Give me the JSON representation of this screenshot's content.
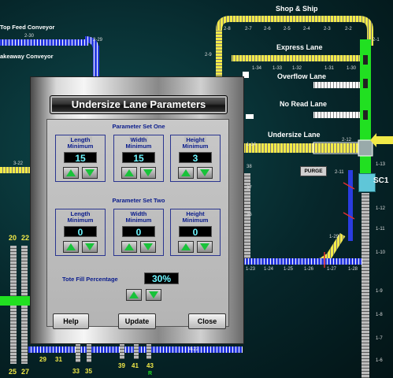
{
  "background_labels": {
    "top_feed": "Top Feed Conveyor",
    "takeaway": "akeaway Conveyor",
    "shop_ship": "Shop & Ship",
    "express": "Express Lane",
    "overflow": "Overflow Lane",
    "no_read": "No Read Lane",
    "undersize": "Undersize Lane",
    "purge": "PURGE",
    "sc1": "SC1",
    "n2_30": "2-30",
    "n2_29": "2-29",
    "n2_9": "2-9",
    "n2_8": "2-8",
    "n2_7": "2-7",
    "n2_6": "2-6",
    "n2_5": "2-5",
    "n2_4": "2-4",
    "n2_3": "2-3",
    "n2_2": "2-2",
    "n2_1": "2-1",
    "n1_34": "1-34",
    "n1_33": "1-33",
    "n1_32": "1-32",
    "n1_31": "1-31",
    "n1_30": "1-30",
    "n1_14": "1-14",
    "n1_13": "1-13",
    "n1_12": "1-12",
    "n1_11": "1-11",
    "n1_10": "1-10",
    "n1_9": "1-9",
    "n1_8": "1-8",
    "n1_7": "1-7",
    "n1_6": "1-6",
    "n2_12": "2-12",
    "n2_11": "2-11",
    "n3_22": "3-22",
    "n1_23": "1-23",
    "n1_24": "1-24",
    "n1_25": "1-25",
    "n1_26": "1-26",
    "n1_27": "1-27",
    "n1_28": "1-28",
    "n1_29": "1-29",
    "n4_22": "4-22",
    "n38": "38",
    "n37": "37",
    "n36": "36",
    "c20": "20",
    "c22": "22",
    "c25": "25",
    "c27": "27",
    "c29": "29",
    "c31": "31",
    "c33": "33",
    "c35": "35",
    "c39": "39",
    "c41": "41",
    "c43": "43",
    "cR": "R"
  },
  "dialog": {
    "title": "Undersize Lane Parameters",
    "set_one": {
      "heading": "Parameter Set One",
      "length": {
        "label": "Length",
        "sub": "Minimum",
        "value": "15"
      },
      "width": {
        "label": "Width",
        "sub": "Minimum",
        "value": "15"
      },
      "height": {
        "label": "Height",
        "sub": "Minimum",
        "value": "3"
      }
    },
    "set_two": {
      "heading": "Parameter Set Two",
      "length": {
        "label": "Length",
        "sub": "Minimum",
        "value": "0"
      },
      "width": {
        "label": "Width",
        "sub": "Minimum",
        "value": "0"
      },
      "height": {
        "label": "Height",
        "sub": "Minimum",
        "value": "0"
      }
    },
    "tote": {
      "label": "Tote Fill Percentage",
      "value": "30%"
    },
    "buttons": {
      "help": "Help",
      "update": "Update",
      "close": "Close"
    }
  },
  "colors": {
    "arrow_up": "#19c23a",
    "display_text": "#6ff6ff",
    "accent": "#0a1c8c",
    "lane_green": "#21e021",
    "lane_yellow": "#f2ea48"
  }
}
